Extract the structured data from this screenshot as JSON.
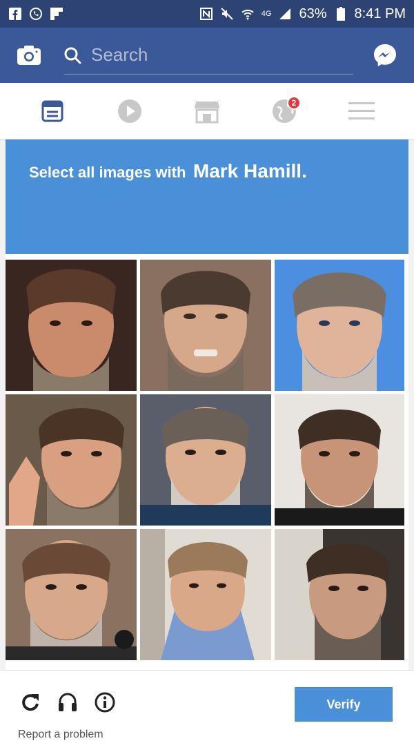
{
  "status_bar": {
    "battery": "63%",
    "time": "8:41 PM",
    "network": "4G",
    "left_icons": [
      "facebook-icon",
      "whatsapp-icon",
      "flipboard-icon"
    ],
    "right_icons": [
      "nfc-icon",
      "mute-icon",
      "wifi-icon",
      "signal-icon",
      "battery-icon"
    ]
  },
  "header": {
    "search_placeholder": "Search",
    "left_icon": "camera-icon",
    "right_icon": "messenger-icon",
    "brand_color": "#3b5998"
  },
  "nav": {
    "tabs": [
      {
        "name": "news-feed",
        "icon": "newsfeed-icon",
        "active": true
      },
      {
        "name": "watch",
        "icon": "play-icon"
      },
      {
        "name": "marketplace",
        "icon": "store-icon"
      },
      {
        "name": "notifications",
        "icon": "globe-icon",
        "badge": "2"
      },
      {
        "name": "menu",
        "icon": "hamburger-icon"
      }
    ]
  },
  "captcha": {
    "prompt_lead": "Select all images with",
    "prompt_target": "Mark Hamill.",
    "accent_color": "#4a90d9",
    "tiles": [
      {
        "id": 1,
        "desc": "person-portrait"
      },
      {
        "id": 2,
        "desc": "person-portrait"
      },
      {
        "id": 3,
        "desc": "person-portrait"
      },
      {
        "id": 4,
        "desc": "person-portrait"
      },
      {
        "id": 5,
        "desc": "person-portrait"
      },
      {
        "id": 6,
        "desc": "person-portrait"
      },
      {
        "id": 7,
        "desc": "person-portrait"
      },
      {
        "id": 8,
        "desc": "person-portrait"
      },
      {
        "id": 9,
        "desc": "person-portrait"
      }
    ],
    "footer": {
      "verify_label": "Verify",
      "report_label": "Report a problem",
      "tools": [
        "reload-icon",
        "audio-icon",
        "info-icon"
      ]
    }
  }
}
